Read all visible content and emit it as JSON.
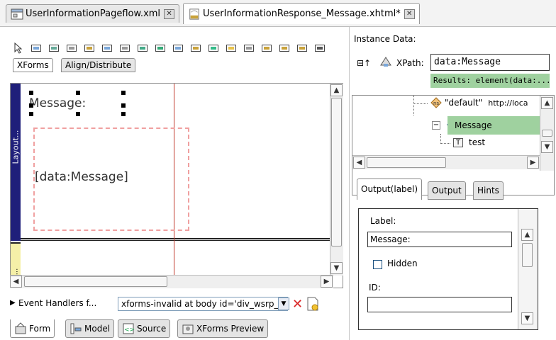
{
  "editor_tabs": [
    {
      "label": "UserInformationPageflow.xml",
      "active": false
    },
    {
      "label": "UserInformationResponse_Message.xhtml*",
      "active": true
    }
  ],
  "palette": {
    "tabs": [
      "XForms",
      "Align/Distribute"
    ],
    "tool_icons": [
      "pointer-tool-icon",
      "input-tool-icon",
      "secret-tool-icon",
      "textarea-tool-icon",
      "output-tool-icon",
      "trigger-tool-icon",
      "upload-tool-icon",
      "range-tool-icon",
      "submit-tool-icon",
      "select-tool-icon",
      "select1-tool-icon",
      "checkbox-tool-icon",
      "image-tool-icon",
      "group-tool-icon",
      "switch-tool-icon",
      "repeat-tool-icon",
      "case-tool-icon",
      "label-tool-icon"
    ]
  },
  "canvas": {
    "side_labels": [
      "Layout...",
      "..."
    ],
    "output_label": "Message:",
    "output_binding": "[data:Message]"
  },
  "event_handlers": {
    "label": "Event Handlers f...",
    "selected": "xforms-invalid at body id='div_wsrp_..."
  },
  "view_tabs": [
    "Form",
    "Model",
    "Source",
    "XForms Preview"
  ],
  "instance": {
    "title": "Instance Data:",
    "xpath_label": "XPath:",
    "xpath_value": "data:Message",
    "results": "Results: element(data:..."
  },
  "tree": {
    "nodes": [
      {
        "kind": "namespace",
        "name": "\"default\"",
        "value": "http://loca",
        "icon": "namespace-icon"
      },
      {
        "kind": "element",
        "name": "Message",
        "selected": true,
        "icon": "element-icon"
      },
      {
        "kind": "text",
        "name": "test",
        "icon": "text-node-icon"
      }
    ]
  },
  "props": {
    "tabs": [
      "Output(label)",
      "Output",
      "Hints"
    ],
    "label_caption": "Label:",
    "label_value": "Message:",
    "hidden_caption": "Hidden",
    "id_caption": "ID:"
  },
  "colors": {
    "selection_green": "#9fd19f",
    "layout_bar": "#1f1f7a",
    "yellow_bar": "#f5f0a8",
    "guide_line": "#c0392b",
    "dashed_box": "#f0a0a0"
  }
}
